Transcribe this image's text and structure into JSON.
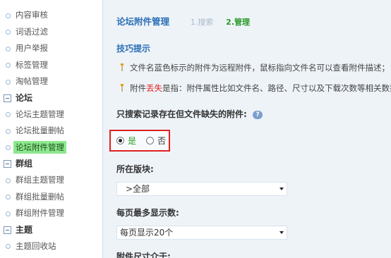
{
  "sidebar": {
    "items_top": [
      {
        "label": "内容审核"
      },
      {
        "label": "词语过滤"
      },
      {
        "label": "用户举报"
      },
      {
        "label": "标签管理"
      },
      {
        "label": "淘帖管理"
      }
    ],
    "groups": [
      {
        "title": "论坛",
        "items": [
          {
            "label": "论坛主题管理"
          },
          {
            "label": "论坛批量删帖"
          },
          {
            "label": "论坛附件管理",
            "active": true
          }
        ]
      },
      {
        "title": "群组",
        "items": [
          {
            "label": "群组主题管理"
          },
          {
            "label": "群组批量删帖"
          },
          {
            "label": "群组附件管理"
          }
        ]
      },
      {
        "title": "主题",
        "items": [
          {
            "label": "主题回收站"
          }
        ]
      }
    ]
  },
  "header": {
    "title": "论坛附件管理",
    "step1": "1.搜索",
    "step2": "2.管理"
  },
  "tips": {
    "title": "技巧提示",
    "line1": "文件名蓝色标示的附件为远程附件，鼠标指向文件名可以查看附件描述；",
    "line2_prefix": "附件",
    "line2_highlight": "丢失",
    "line2_suffix": "是指：附件属性比如文件名、路径、尺寸以及下载次数等相关数据"
  },
  "form": {
    "missing_only_label": "只搜索记录存在但文件缺失的附件:",
    "help_icon_text": "?",
    "radio_yes": "是",
    "radio_no": "否",
    "forum_label": "所在版块:",
    "forum_value": ">全部",
    "perpage_label": "每页最多显示数:",
    "perpage_value": "每页显示20个",
    "size_label": "附件尺寸介于:"
  },
  "colors": {
    "accent_blue": "#2b6fb6",
    "active_green": "#8ee88e",
    "step_green": "#2a9a2a",
    "highlight_red": "#e02020"
  }
}
